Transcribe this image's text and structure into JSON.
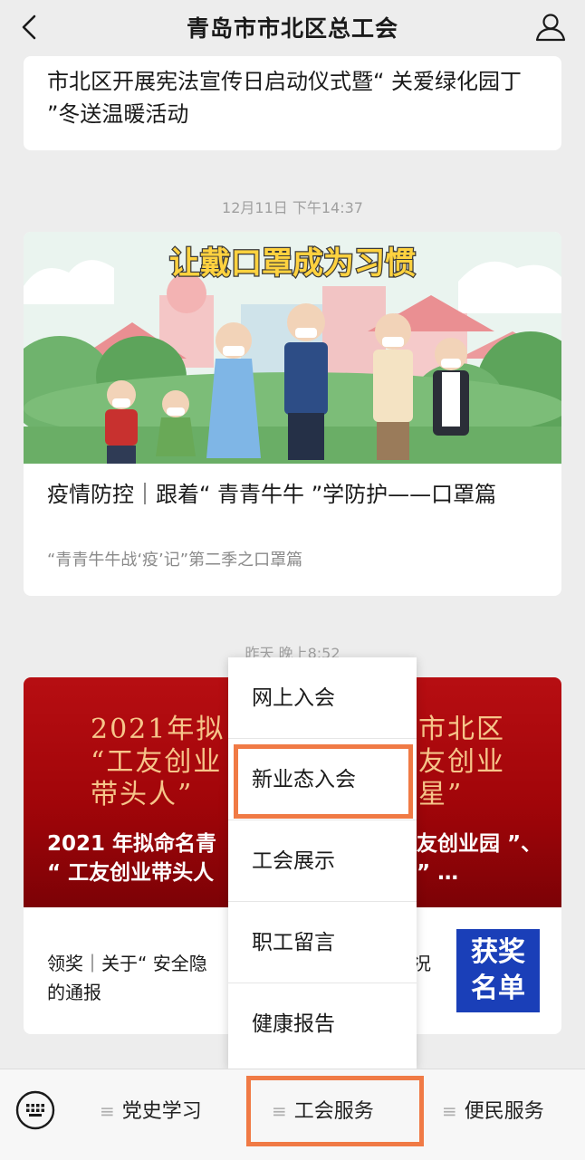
{
  "header": {
    "title": "青岛市市北区总工会"
  },
  "feed": [
    {
      "title": "市北区开展宪法宣传日启动仪式暨“ 关爱绿化园丁 ”冬送温暖活动"
    },
    {
      "time": "12月11日 下午14:37",
      "banner_text": "让戴口罩成为习惯",
      "title": "疫情防控｜跟着“ 青青牛牛 ”学防护——口罩篇",
      "subtitle": "“青青牛牛战‘疫’记”第二季之口罩篇"
    },
    {
      "time": "昨天 晚上8:52",
      "banner_lines_left": [
        "2021年拟",
        "“工友创业",
        "带头人”"
      ],
      "banner_lines_right": [
        "市北区",
        "友创业",
        "星”"
      ],
      "caption_left": [
        "2021 年拟命名青",
        "“ 工友创业带头人"
      ],
      "caption_right": [
        "友创业园 ”、",
        "” …"
      ],
      "item_text_left": "领奖｜关于“ 安全隐",
      "item_text_right": "况",
      "item_text_line2": "的通报",
      "award_badge": [
        "获奖",
        "名单"
      ]
    }
  ],
  "popup_menu": {
    "items": [
      "网上入会",
      "新业态入会",
      "工会展示",
      "职工留言",
      "健康报告"
    ],
    "highlighted_index": 1
  },
  "bottom_menu": {
    "tabs": [
      "党史学习",
      "工会服务",
      "便民服务"
    ],
    "highlighted_index": 1,
    "highlight_color": "#f07a45"
  }
}
